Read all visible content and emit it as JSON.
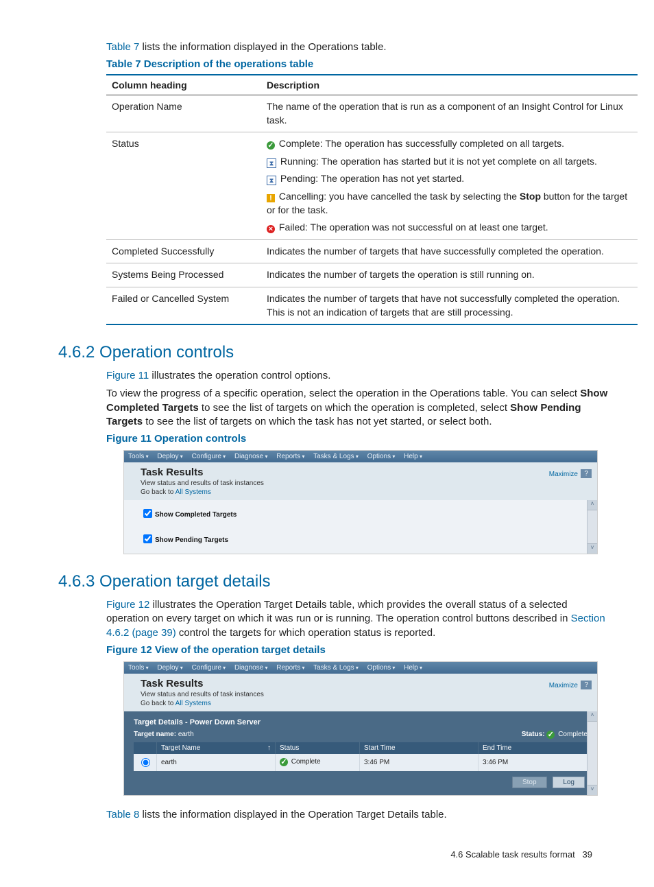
{
  "intro1_pre": " lists the information displayed in the Operations table.",
  "link_table7": "Table 7",
  "caption_t7": "Table 7 Description of the operations table",
  "th_col": "Column heading",
  "th_desc": "Description",
  "rows": [
    {
      "col": "Operation Name",
      "desc": "The name of the operation that is run as a component of an Insight Control for Linux task."
    },
    {
      "col": "Completed Successfully",
      "desc": "Indicates the number of targets that have successfully completed the operation."
    },
    {
      "col": "Systems Being Processed",
      "desc": "Indicates the number of targets the operation is still running on."
    },
    {
      "col": "Failed or Cancelled System",
      "desc": "Indicates the number of targets that have not successfully completed the operation. This is not an indication of targets that are still processing."
    }
  ],
  "status_label": "Status",
  "status_items": [
    "Complete: The operation has successfully completed on all targets.",
    "Running: The operation has started but it is not yet complete on all targets.",
    "Pending: The operation has not yet started.",
    "Failed: The operation was not successful on at least one target."
  ],
  "status_cancel_pre": "Cancelling: you have cancelled the task by selecting the ",
  "status_cancel_bold": "Stop",
  "status_cancel_post": " button for the target or for the task.",
  "h_462": "4.6.2 Operation controls",
  "p_462a_pre": " illustrates the operation control options.",
  "link_fig11": "Figure 11",
  "p_462b_pre": "To view the progress of a specific operation, select the operation in the Operations table. You can select ",
  "p_462b_b1": "Show Completed Targets",
  "p_462b_mid": " to see the list of targets on which the operation is completed, select ",
  "p_462b_b2": "Show Pending Targets",
  "p_462b_post": " to see the list of targets on which the task has not yet started, or select both.",
  "caption_f11": "Figure 11 Operation controls",
  "menu": [
    "Tools",
    "Deploy",
    "Configure",
    "Diagnose",
    "Reports",
    "Tasks & Logs",
    "Options",
    "Help"
  ],
  "tr_title": "Task Results",
  "tr_sub": "View status and results of task instances",
  "tr_back_pre": "Go back to ",
  "tr_back_link": "All Systems",
  "maximize": "Maximize",
  "chk1": "Show Completed Targets",
  "chk2": "Show Pending Targets",
  "h_463": "4.6.3 Operation target details",
  "p_463_pre": " illustrates the Operation Target Details table, which provides the overall status of a selected operation on every target on which it was run or is running. The operation control buttons described in ",
  "link_fig12": "Figure 12",
  "link_sec462": "Section 4.6.2 (page 39)",
  "p_463_post": " control the targets for which operation status is reported.",
  "caption_f12": "Figure 12 View of the operation target details",
  "td_title": "Target Details - Power Down Server",
  "td_target_label": "Target name: ",
  "td_target_value": "earth",
  "td_status_label": "Status: ",
  "td_status_value": "Complete",
  "grid_headers": [
    "",
    "Target Name",
    "Status",
    "Start Time",
    "End Time"
  ],
  "grid_row": {
    "name": "earth",
    "status": "Complete",
    "start": "3:46 PM",
    "end": "3:46 PM"
  },
  "btn_stop": "Stop",
  "btn_log": "Log",
  "intro2_pre": " lists the information displayed in the Operation Target Details table.",
  "link_table8": "Table 8",
  "footer_sec": "4.6 Scalable task results format",
  "footer_pg": "39"
}
